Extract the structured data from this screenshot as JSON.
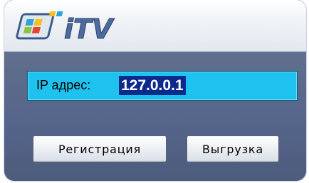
{
  "logo": {
    "text": "iTV",
    "icon": "itv-logo-icon",
    "colors": [
      "#2ea3d9",
      "#f5c21b",
      "#e8432c",
      "#8cc63e"
    ]
  },
  "form": {
    "ip_label": "IP адрес:",
    "ip_value": "127.0.0.1"
  },
  "buttons": {
    "register_label": "Регистрация",
    "upload_label": "Выгрузка"
  },
  "colors": {
    "field_bg": "#1fc2ee",
    "selection_bg": "#0b2b8c",
    "panel_bg": "#5d6c8c"
  }
}
